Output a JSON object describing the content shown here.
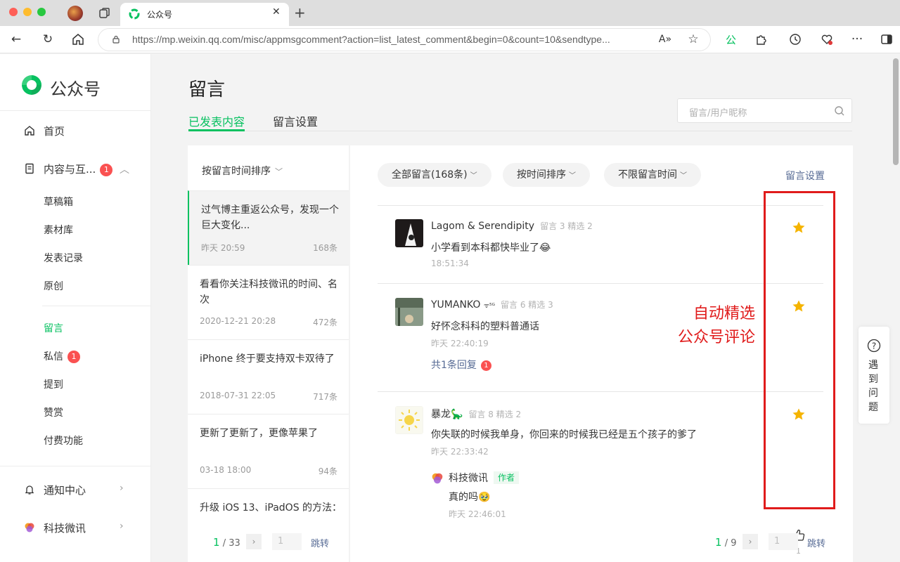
{
  "browser": {
    "tab_title": "公众号",
    "url_host": "https://mp.weixin.qq.com",
    "url_rest": "/misc/appmsgcomment?action=list_latest_comment&begin=0&count=10&sendtype..."
  },
  "sidebar": {
    "brand": "公众号",
    "home": "首页",
    "content": {
      "label": "内容与互...",
      "badge": "1"
    },
    "content_items": [
      "草稿箱",
      "素材库",
      "发表记录",
      "原创"
    ],
    "interact_items": [
      {
        "label": "留言",
        "active": true
      },
      {
        "label": "私信",
        "badge": "1"
      },
      {
        "label": "提到"
      },
      {
        "label": "赞赏"
      },
      {
        "label": "付费功能"
      }
    ],
    "notify": "通知中心",
    "account": "科技微讯"
  },
  "main": {
    "title": "留言",
    "tabs": [
      "已发表内容",
      "留言设置"
    ],
    "search_placeholder": "留言/用户昵称"
  },
  "articles": {
    "sort_label": "按留言时间排序",
    "items": [
      {
        "title": "过气博主重返公众号，发现一个巨大变化...",
        "date": "昨天 20:59",
        "count": "168条",
        "selected": true
      },
      {
        "title": "看看你关注科技微讯的时间、名次",
        "date": "2020-12-21 20:28",
        "count": "472条"
      },
      {
        "title": "iPhone 终于要支持双卡双待了",
        "date": "2018-07-31 22:05",
        "count": "717条"
      },
      {
        "title": "更新了更新了，更像苹果了",
        "date": "03-18 18:00",
        "count": "94条"
      },
      {
        "title": "升级 iOS 13、iPadOS 的方法：",
        "date": "",
        "count": ""
      }
    ],
    "pager": {
      "current": "1",
      "total": "/ 33",
      "input": "1",
      "jump": "跳转"
    }
  },
  "comments": {
    "filters": [
      "全部留言(168条)",
      "按时间排序",
      "不限留言时间"
    ],
    "settings_link": "留言设置",
    "items": [
      {
        "name": "Lagom & Serendipity",
        "meta": "留言 3 精选 2",
        "text": "小学看到本科都快毕业了😂",
        "time": "18:51:34",
        "starred": true
      },
      {
        "name": "YUMANKO ",
        "meta": "留言 6 精选 3",
        "text": "好怀念科科的塑料普通话",
        "time": "昨天 22:40:19",
        "reply_label": "共1条回复",
        "reply_badge": "1",
        "starred": true
      },
      {
        "name": "暴龙🦕",
        "meta": "留言 8 精选 2",
        "text": "你失联的时候我单身，你回来的时候我已经是五个孩子的爹了",
        "time": "昨天 22:33:42",
        "starred": true,
        "author_reply": {
          "name": "科技微讯",
          "tag": "作者",
          "text": "真的吗🥹",
          "time": "昨天 22:46:01",
          "likes": "1"
        }
      }
    ],
    "pager": {
      "current": "1",
      "total": "/ 9",
      "input": "1",
      "jump": "跳转"
    }
  },
  "annotation": {
    "line1": "自动精选",
    "line2": "公众号评论"
  },
  "help": {
    "label": "遇到问题"
  },
  "colors": {
    "accent": "#07c160",
    "link": "#576b95",
    "badge": "#fa5151",
    "annotation": "#e01b1b",
    "star": "#f5b400"
  }
}
